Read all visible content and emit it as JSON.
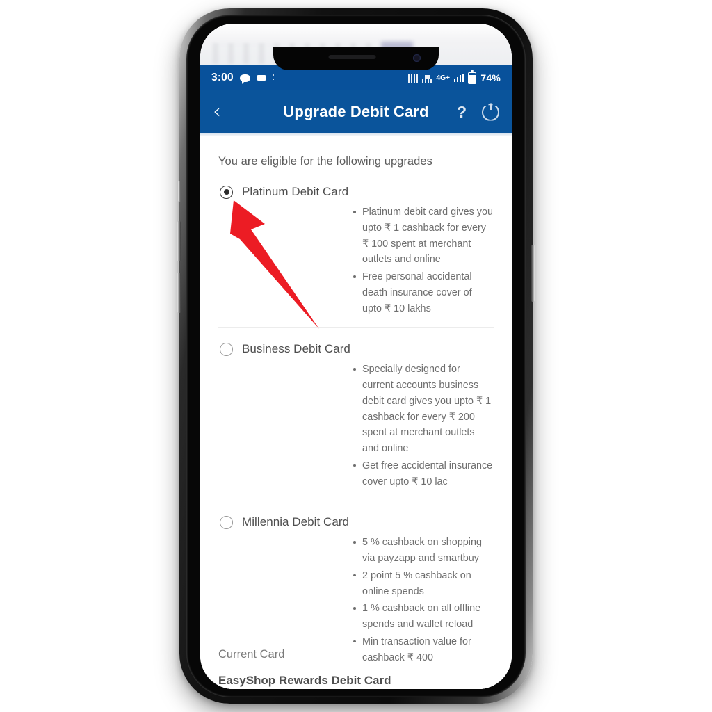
{
  "statusbar": {
    "clock": "3:00",
    "icons_left": [
      "chat-bubble-icon",
      "message-icon",
      "more-icon"
    ],
    "icons_right": [
      "sim1-signal-icon",
      "sim2-signal-icon",
      "network-4g-label",
      "signal-bars-icon",
      "battery-icon"
    ],
    "network_label": "4G+",
    "battery_percent": "74%"
  },
  "appbar": {
    "back_icon": "chevron-left-icon",
    "title": "Upgrade Debit Card",
    "help_label": "?",
    "power_icon": "power-icon"
  },
  "main": {
    "eligible_heading": "You are eligible for the following upgrades",
    "options": [
      {
        "label": "Platinum Debit Card",
        "selected": true,
        "benefits": [
          "Platinum debit card gives you upto ₹ 1 cashback for every ₹ 100 spent at merchant outlets and online",
          "Free personal accidental death insurance cover of upto ₹ 10 lakhs"
        ]
      },
      {
        "label": "Business Debit Card",
        "selected": false,
        "benefits": [
          "Specially designed for current accounts business debit card gives you upto ₹ 1 cashback for every ₹ 200 spent at merchant outlets and online",
          "Get free accidental insurance cover upto ₹ 10 lac"
        ]
      },
      {
        "label": "Millennia Debit Card",
        "selected": false,
        "benefits": [
          "5 % cashback on shopping via payzapp and smartbuy",
          "2 point 5 % cashback on online spends",
          "1 % cashback on all offline spends and wallet reload",
          "Min transaction value for cashback ₹ 400"
        ]
      }
    ],
    "current_card_label": "Current Card",
    "current_card_name": "EasyShop Rewards Debit Card"
  },
  "annotation": {
    "type": "arrow",
    "color": "#ec1c24",
    "points_to": "platinum-debit-card-radio"
  },
  "colors": {
    "header_blue": "#0a549b",
    "statusbar_blue": "#08519b",
    "body_text": "#6e6e6e",
    "label_text": "#4e4e4e",
    "arrow_red": "#ec1c24"
  }
}
